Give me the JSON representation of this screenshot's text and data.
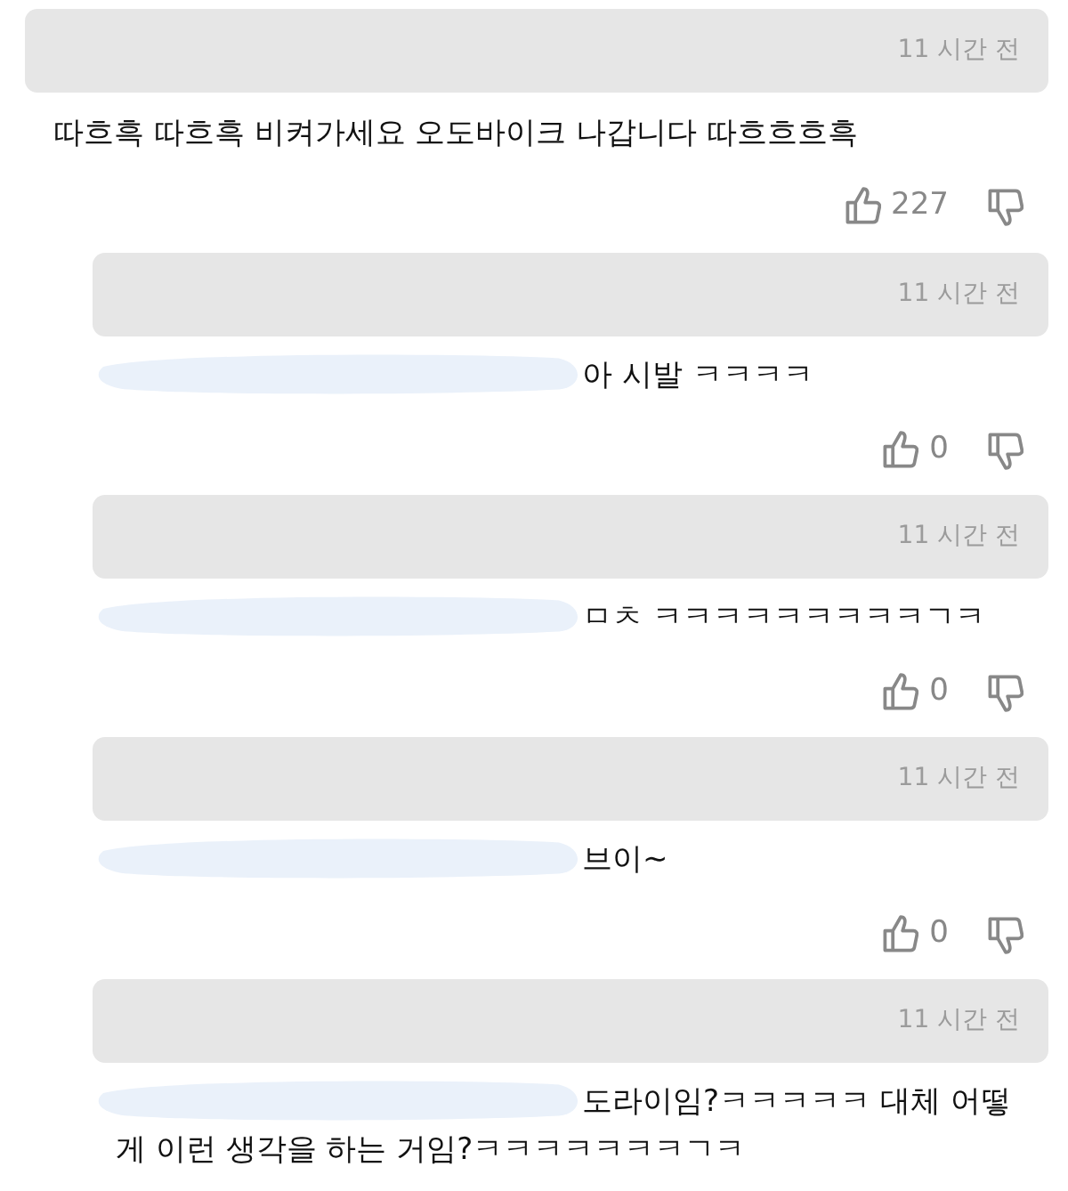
{
  "comment": {
    "time": "11 시간 전",
    "text": "따흐흑 따흐흑 비켜가세요 오도바이크 나갑니다 따흐흐흐흑",
    "likes": "227"
  },
  "replies": [
    {
      "time": "11 시간 전",
      "text": "아 시발 ㅋㅋㅋㅋ",
      "likes": "0",
      "redacted": true
    },
    {
      "time": "11 시간 전",
      "text": "ㅁㅊ ㅋㅋㅋㅋㅋㅋㅋㅋㅋㄱㅋ",
      "likes": "0",
      "redacted": true
    },
    {
      "time": "11 시간 전",
      "text": "브이~",
      "likes": "0",
      "redacted": true
    },
    {
      "time": "11 시간 전",
      "text": "도라이임?ㅋㅋㅋㅋㅋ 대체 어떻게 이런 생각을 하는 거임?ㅋㅋㅋㅋㅋㅋㅋㄱㅋ",
      "redacted": true
    }
  ]
}
